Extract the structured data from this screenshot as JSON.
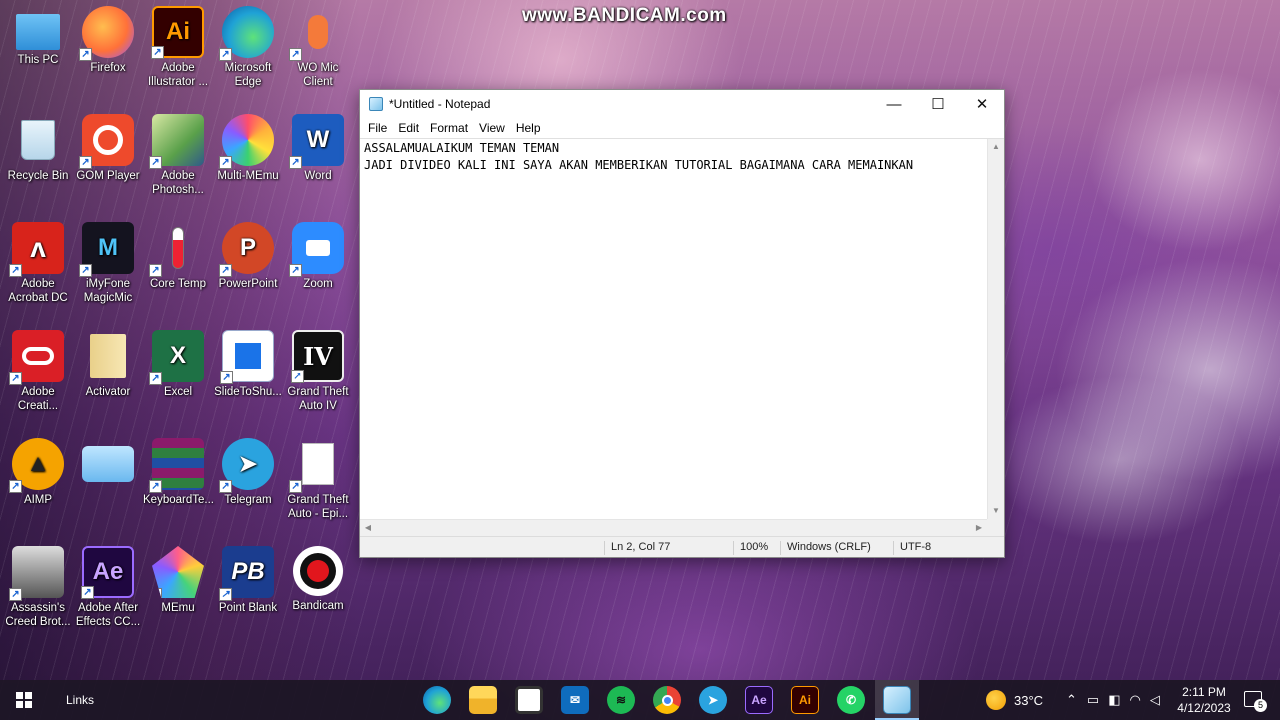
{
  "watermark": "www.BANDICAM.com",
  "desktop_icons": [
    {
      "label": "This PC"
    },
    {
      "label": "Firefox"
    },
    {
      "label": "Adobe Illustrator ..."
    },
    {
      "label": "Microsoft Edge"
    },
    {
      "label": "WO Mic Client"
    },
    {
      "label": "Recycle Bin"
    },
    {
      "label": "GOM Player"
    },
    {
      "label": "Adobe Photosh..."
    },
    {
      "label": "Multi-MEmu"
    },
    {
      "label": "Word"
    },
    {
      "label": "Adobe Acrobat DC"
    },
    {
      "label": "iMyFone MagicMic"
    },
    {
      "label": "Core Temp"
    },
    {
      "label": "PowerPoint"
    },
    {
      "label": "Zoom"
    },
    {
      "label": "Adobe Creati..."
    },
    {
      "label": "Activator"
    },
    {
      "label": "Excel"
    },
    {
      "label": "SlideToShu..."
    },
    {
      "label": "Grand Theft Auto IV"
    },
    {
      "label": "AIMP"
    },
    {
      "label": ""
    },
    {
      "label": "KeyboardTe..."
    },
    {
      "label": "Telegram"
    },
    {
      "label": "Grand Theft Auto - Epi..."
    },
    {
      "label": "Assassin's Creed Brot..."
    },
    {
      "label": "Adobe After Effects CC..."
    },
    {
      "label": "MEmu"
    },
    {
      "label": "Point Blank"
    },
    {
      "label": "Bandicam"
    }
  ],
  "notepad": {
    "title": "*Untitled - Notepad",
    "menu": [
      "File",
      "Edit",
      "Format",
      "View",
      "Help"
    ],
    "lines": [
      "ASSALAMUALAIKUM TEMAN TEMAN",
      "JADI DIVIDEO KALI INI SAYA AKAN MEMBERIKAN TUTORIAL BAGAIMANA CARA MEMAINKAN"
    ],
    "status": {
      "position": "Ln 2, Col 77",
      "zoom": "100%",
      "line_ending": "Windows (CRLF)",
      "encoding": "UTF-8"
    }
  },
  "taskbar": {
    "links_label": "Links",
    "apps": [
      "edge",
      "file-explorer",
      "store",
      "mail",
      "spotify",
      "chrome",
      "telegram",
      "after-effects",
      "illustrator",
      "whatsapp",
      "notepad"
    ],
    "ae_label": "Ae",
    "ai_label": "Ai",
    "weather": "33°C",
    "time": "2:11 PM",
    "date": "4/12/2023",
    "notification_count": "5"
  }
}
